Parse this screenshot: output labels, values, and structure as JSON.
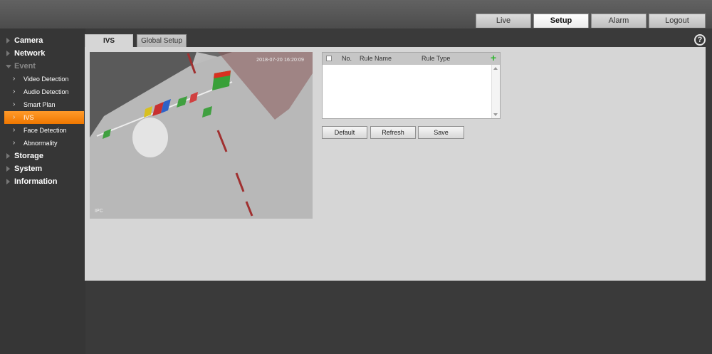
{
  "topnav": {
    "tabs": [
      {
        "label": "Live"
      },
      {
        "label": "Setup"
      },
      {
        "label": "Alarm"
      },
      {
        "label": "Logout"
      }
    ],
    "active": "Setup"
  },
  "sidebar": {
    "items": [
      {
        "label": "Camera"
      },
      {
        "label": "Network"
      },
      {
        "label": "Event"
      },
      {
        "label": "Video Detection"
      },
      {
        "label": "Audio Detection"
      },
      {
        "label": "Smart Plan"
      },
      {
        "label": "IVS"
      },
      {
        "label": "Face Detection"
      },
      {
        "label": "Abnormality"
      },
      {
        "label": "Storage"
      },
      {
        "label": "System"
      },
      {
        "label": "Information"
      }
    ],
    "active": "IVS"
  },
  "tabs": {
    "ivs": "IVS",
    "global": "Global Setup"
  },
  "help": "?",
  "video": {
    "timestamp": "2018-07-20 16:20:09",
    "channel": "IPC"
  },
  "rule_table": {
    "col_no": "No.",
    "col_name": "Rule Name",
    "col_type": "Rule Type",
    "add_icon": "+"
  },
  "buttons": {
    "default": "Default",
    "refresh": "Refresh",
    "save": "Save"
  },
  "colors": {
    "accent": "#f08a1c",
    "sidebar_bg": "#363636",
    "panel_bg": "#d6d6d6"
  }
}
